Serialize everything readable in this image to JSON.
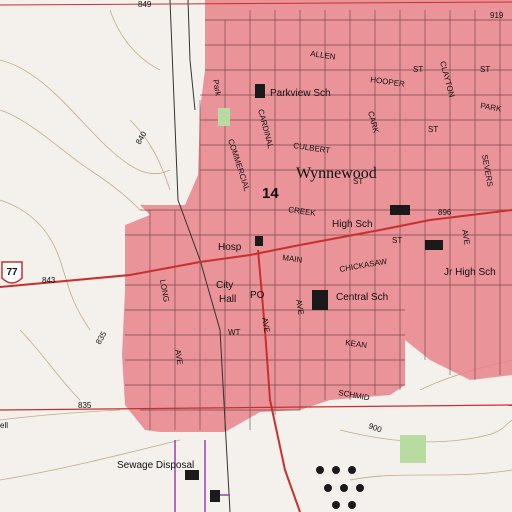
{
  "map": {
    "colors": {
      "urban": "#e8828a",
      "urban_dark": "#d65a66",
      "background": "#f4f1ec",
      "road_major": "#c83030",
      "contour": "#a0804a",
      "street": "#444444",
      "green": "#b7dba0",
      "building": "#1a1a1a",
      "water": "#6ab0ff",
      "purple": "#9a3fb0"
    },
    "town_label": "Wynnewood",
    "route_shields": {
      "us": "77",
      "state": "14"
    },
    "places": [
      {
        "id": "parkview",
        "text": "Parkview Sch"
      },
      {
        "id": "high",
        "text": "High Sch"
      },
      {
        "id": "hosp",
        "text": "Hosp"
      },
      {
        "id": "jrhigh",
        "text": "Jr High Sch"
      },
      {
        "id": "city",
        "text": "City"
      },
      {
        "id": "hall",
        "text": "Hall"
      },
      {
        "id": "po",
        "text": "PO"
      },
      {
        "id": "central",
        "text": "Central Sch"
      },
      {
        "id": "sewage",
        "text": "Sewage Disposal"
      }
    ],
    "streets": [
      {
        "id": "allen",
        "text": "ALLEN"
      },
      {
        "id": "hooper",
        "text": "HOOPER"
      },
      {
        "id": "culbert",
        "text": "CULBERT"
      },
      {
        "id": "creek",
        "text": "CREEK"
      },
      {
        "id": "main",
        "text": "MAIN"
      },
      {
        "id": "chickasaw",
        "text": "CHICKASAW"
      },
      {
        "id": "kean",
        "text": "KEAN"
      },
      {
        "id": "schmid",
        "text": "SCHMID"
      },
      {
        "id": "wt",
        "text": "WT"
      },
      {
        "id": "long",
        "text": "LONG"
      },
      {
        "id": "commercial",
        "text": "COMMERCIAL"
      },
      {
        "id": "cardinal",
        "text": "CARDINAL"
      },
      {
        "id": "clayton",
        "text": "CLAYTON"
      },
      {
        "id": "severs",
        "text": "SEVERS"
      },
      {
        "id": "park",
        "text": "Park"
      },
      {
        "id": "ave_n",
        "text": "AVE"
      },
      {
        "id": "ave_e",
        "text": "AVE"
      },
      {
        "id": "ave_s",
        "text": "AVE"
      },
      {
        "id": "ave_w",
        "text": "AVE"
      },
      {
        "id": "st_1",
        "text": "ST"
      },
      {
        "id": "st_2",
        "text": "ST"
      },
      {
        "id": "st_3",
        "text": "ST"
      },
      {
        "id": "st_4",
        "text": "ST"
      },
      {
        "id": "st_5",
        "text": "ST"
      },
      {
        "id": "park_label",
        "text": "PARK"
      },
      {
        "id": "cark",
        "text": "CARK"
      }
    ],
    "elevations": [
      {
        "id": "e849",
        "text": "849"
      },
      {
        "id": "e840",
        "text": "840"
      },
      {
        "id": "e843",
        "text": "843"
      },
      {
        "id": "e835a",
        "text": "835"
      },
      {
        "id": "e835b",
        "text": "835"
      },
      {
        "id": "e896",
        "text": "896"
      },
      {
        "id": "e900",
        "text": "900"
      },
      {
        "id": "e919",
        "text": "919"
      },
      {
        "id": "e_ell",
        "text": "ell"
      }
    ]
  }
}
